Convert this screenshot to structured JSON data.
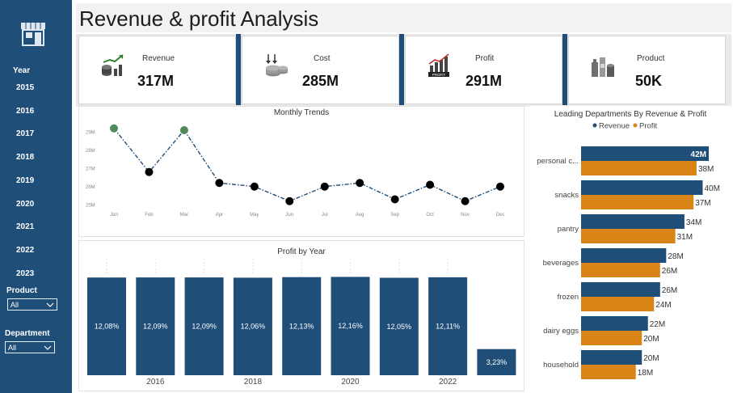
{
  "page": {
    "title": "Revenue & profit Analysis"
  },
  "sidebar": {
    "year_label": "Year",
    "years": [
      "2015",
      "2016",
      "2017",
      "2018",
      "2019",
      "2020",
      "2021",
      "2022",
      "2023"
    ],
    "product_label": "Product",
    "product_value": "All",
    "department_label": "Department",
    "department_value": "All",
    "icons": {
      "logo": "store-icon",
      "dropdown": "chevron-down-icon"
    }
  },
  "kpis": [
    {
      "label": "Revenue",
      "value": "317M",
      "icon": "revenue-growth-icon"
    },
    {
      "label": "Cost",
      "value": "285M",
      "icon": "coins-cost-icon"
    },
    {
      "label": "Profit",
      "value": "291M",
      "icon": "profit-chart-icon"
    },
    {
      "label": "Product",
      "value": "50K",
      "icon": "grocery-products-icon"
    }
  ],
  "colors": {
    "navy": "#1f4e79",
    "orange": "#d98417",
    "green_point": "#4e8a5a",
    "point": "#000000"
  },
  "chart_data": [
    {
      "type": "line",
      "title": "Monthly Trends",
      "categories": [
        "Jan",
        "Feb",
        "Mar",
        "Apr",
        "May",
        "Jun",
        "Jul",
        "Aug",
        "Sep",
        "Oct",
        "Nov",
        "Dec"
      ],
      "values": [
        29.2,
        26.8,
        29.1,
        26.2,
        26.0,
        25.2,
        26.0,
        26.2,
        25.3,
        26.1,
        25.2,
        26.0
      ],
      "highlight": [
        true,
        false,
        true,
        false,
        false,
        false,
        false,
        false,
        false,
        false,
        false,
        false
      ],
      "yticks": [
        "29M",
        "28M",
        "27M",
        "26M",
        "25M"
      ],
      "ytick_values": [
        29,
        28,
        27,
        26,
        25
      ],
      "ylim": [
        24.7,
        29.5
      ],
      "grid": false,
      "line_style": "dash-dot"
    },
    {
      "type": "bar",
      "title": "Profit by Year",
      "categories": [
        "2015",
        "2016",
        "2017",
        "2018",
        "2019",
        "2020",
        "2021",
        "2022",
        "2023"
      ],
      "values": [
        12.08,
        12.09,
        12.09,
        12.06,
        12.13,
        12.16,
        12.05,
        12.11,
        3.23
      ],
      "labels": [
        "12,08%",
        "12,09%",
        "12,09%",
        "12,06%",
        "12,13%",
        "12,16%",
        "12,05%",
        "12,11%",
        "3,23%"
      ],
      "xtick_labels": [
        "2016",
        "2018",
        "2020",
        "2022"
      ],
      "ylim": [
        0,
        12.5
      ],
      "grid": false
    },
    {
      "type": "bar",
      "orientation": "horizontal",
      "title": "Leading Departments By Revenue & Profit",
      "categories": [
        "personal c...",
        "snacks",
        "pantry",
        "beverages",
        "frozen",
        "dairy eggs",
        "household"
      ],
      "series": [
        {
          "name": "Revenue",
          "values": [
            42,
            40,
            34,
            28,
            26,
            22,
            20
          ],
          "labels": [
            "42M",
            "40M",
            "34M",
            "28M",
            "26M",
            "22M",
            "20M"
          ]
        },
        {
          "name": "Profit",
          "values": [
            38,
            37,
            31,
            26,
            24,
            20,
            18
          ],
          "labels": [
            "38M",
            "37M",
            "31M",
            "26M",
            "24M",
            "20M",
            "18M"
          ]
        }
      ],
      "legend": "top-center",
      "xlim": [
        0,
        42
      ]
    }
  ]
}
